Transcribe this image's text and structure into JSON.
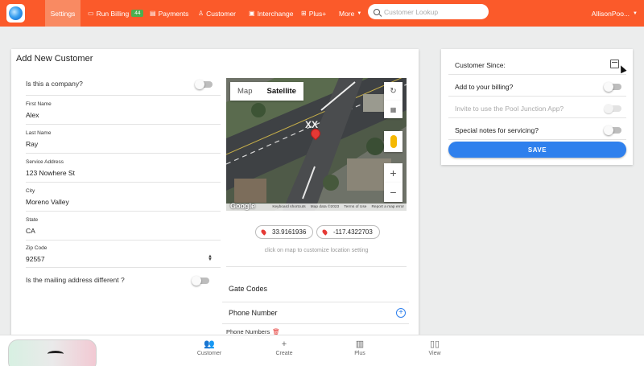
{
  "topbar": {
    "nav": [
      {
        "label": "Settings",
        "icon": ""
      },
      {
        "label": "Run Billing",
        "icon": "credit-card-icon",
        "badge": "44"
      },
      {
        "label": "Payments",
        "icon": "receipt-icon"
      },
      {
        "label": "Customer",
        "icon": "person-add-icon"
      },
      {
        "label": "Interchange",
        "icon": "tray-icon"
      },
      {
        "label": "Plus+",
        "icon": "chart-icon"
      },
      {
        "label": "More",
        "icon": "chevron-down-icon"
      }
    ],
    "search_placeholder": "Customer Lookup",
    "user": "AllisonPoo..."
  },
  "form": {
    "title": "Add New Customer",
    "company_question": "Is this a company?",
    "first_name_label": "First Name",
    "first_name": "Alex",
    "last_name_label": "Last Name",
    "last_name": "Ray",
    "address_label": "Service Address",
    "address": "123 Nowhere St",
    "city_label": "City",
    "city": "Moreno Valley",
    "state_label": "State",
    "state": "CA",
    "zip_label": "Zip Code",
    "zip": "92557",
    "mailing_question": "Is the mailing address different ?"
  },
  "map": {
    "tab_map": "Map",
    "tab_satellite": "Satellite",
    "footer_google": "Google",
    "footer_shortcuts": "Keyboard shortcuts",
    "footer_data": "Map data ©2023",
    "footer_terms": "Terms of Use",
    "footer_report": "Report a map error",
    "latitude": "33.9161936",
    "longitude": "-117.4322703",
    "hint": "click on map to customize location setting",
    "road_marking": "XX"
  },
  "sections": {
    "gate_codes": "Gate Codes",
    "phone_number": "Phone Number",
    "phone_numbers": "Phone Numbers"
  },
  "side": {
    "customer_since": "Customer Since:",
    "add_billing": "Add to your billing?",
    "invite": "Invite to use the Pool Junction App?",
    "special_notes": "Special notes for servicing?",
    "save": "SAVE"
  },
  "bottom_nav": [
    {
      "label": "Customer",
      "icon": "people-icon"
    },
    {
      "label": "Create",
      "icon": "plus-icon"
    },
    {
      "label": "Plus",
      "icon": "map-icon"
    },
    {
      "label": "View",
      "icon": "book-icon"
    }
  ],
  "colors": {
    "brand": "#fb5a2a",
    "accent": "#2f80ed",
    "badge": "#4caf50"
  }
}
